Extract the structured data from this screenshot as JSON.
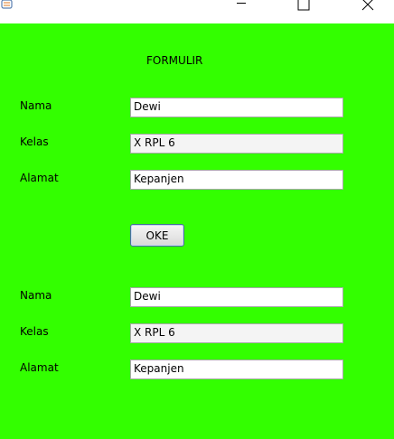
{
  "window": {
    "app_icon": "java-coffee-cup-icon",
    "controls": [
      "minimize-icon",
      "maximize-icon",
      "close-icon"
    ]
  },
  "form": {
    "heading": "FORMULIR",
    "inputs": {
      "nama_label": "Nama",
      "nama_value": "Dewi",
      "kelas_label": "Kelas",
      "kelas_value": "X RPL 6",
      "alamat_label": "Alamat",
      "alamat_value": "Kepanjen"
    },
    "ok_button": "OKE",
    "outputs": {
      "nama_label": "Nama",
      "nama_value": "Dewi",
      "kelas_label": "Kelas",
      "kelas_value": "X RPL 6",
      "alamat_label": "Alamat",
      "alamat_value": "Kepanjen"
    }
  },
  "colors": {
    "background": "#33ff00",
    "titlebar": "#ffffff"
  }
}
